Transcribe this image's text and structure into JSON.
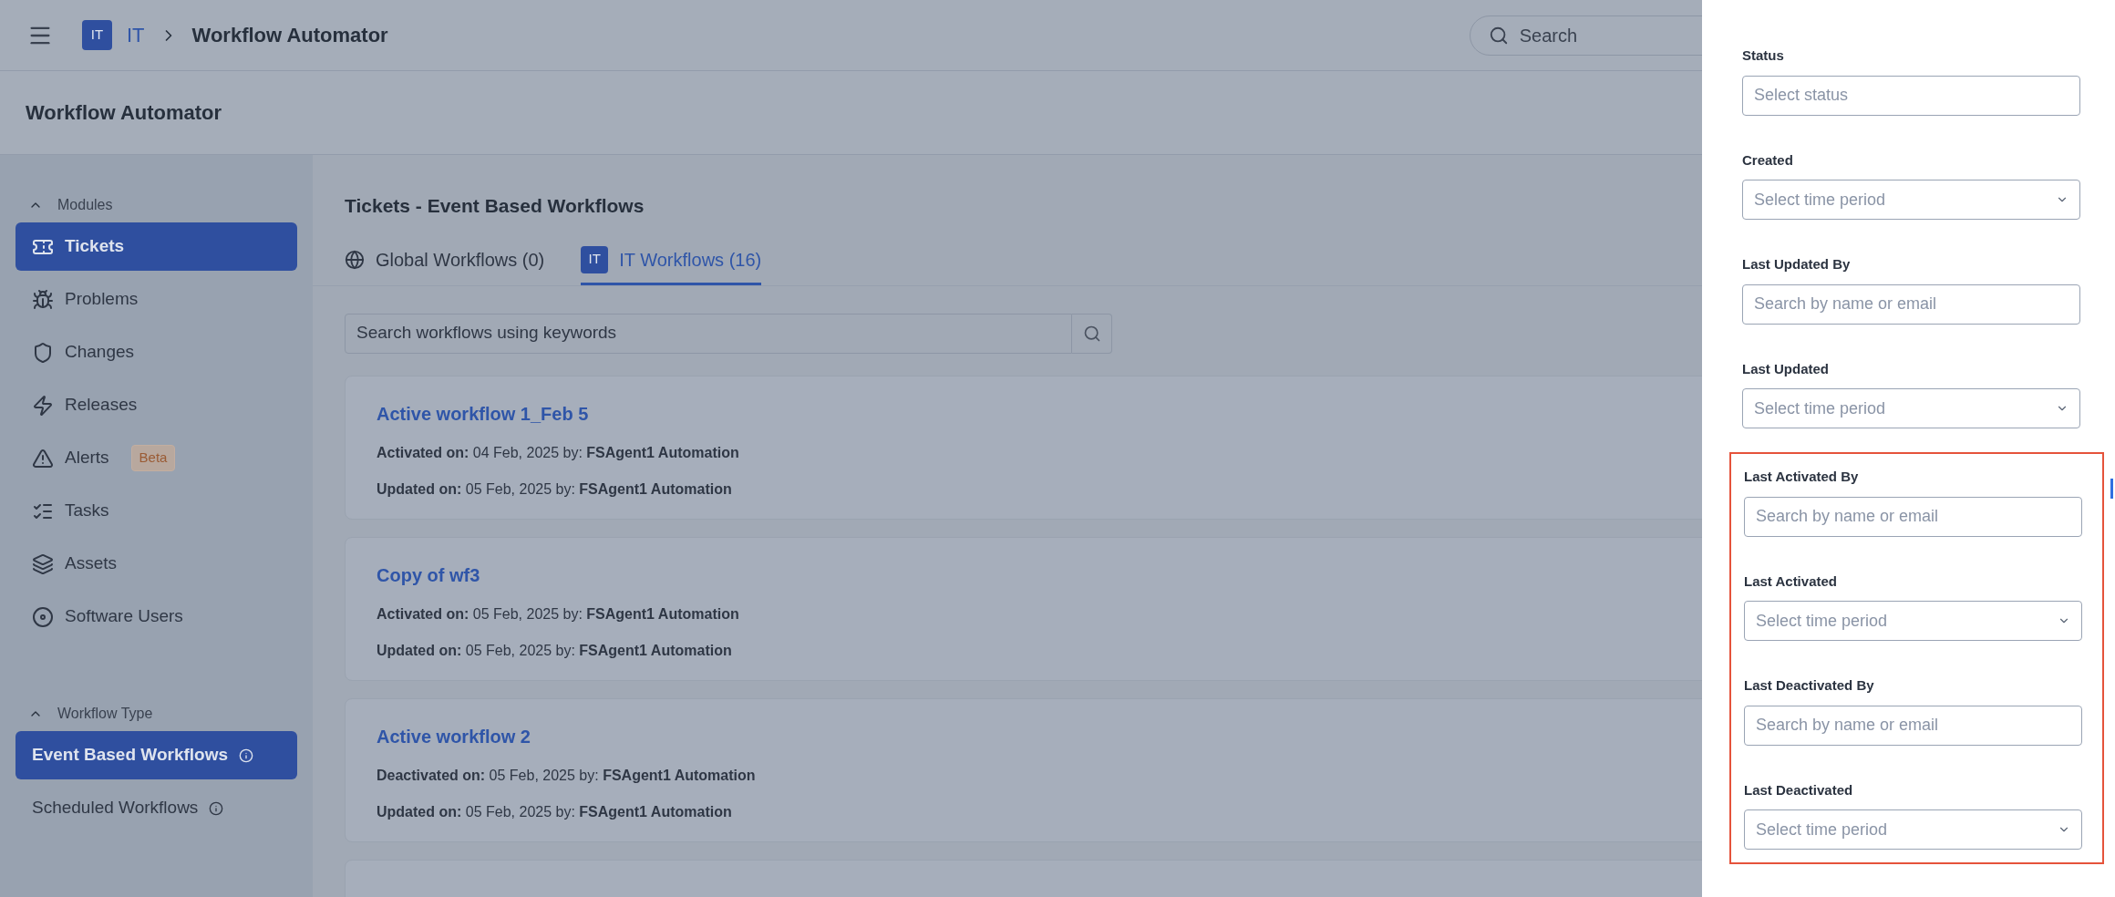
{
  "topbar": {
    "module_badge": "IT",
    "module": "IT",
    "page": "Workflow Automator",
    "search": {
      "placeholder": "Search"
    }
  },
  "page_header": {
    "title": "Workflow Automator"
  },
  "sidebar": {
    "sections": [
      {
        "title": "Modules",
        "expanded": true,
        "items": [
          {
            "label": "Tickets",
            "selected": true,
            "kind": "ticket"
          },
          {
            "label": "Problems",
            "selected": false,
            "kind": "bug"
          },
          {
            "label": "Changes",
            "selected": false,
            "kind": "shield"
          },
          {
            "label": "Releases",
            "selected": false,
            "kind": "bolt"
          },
          {
            "label": "Alerts",
            "selected": false,
            "kind": "alert",
            "badge": "Beta"
          },
          {
            "label": "Tasks",
            "selected": false,
            "kind": "tasks"
          },
          {
            "label": "Assets",
            "selected": false,
            "kind": "layers"
          },
          {
            "label": "Software Users",
            "selected": false,
            "kind": "software"
          }
        ]
      },
      {
        "title": "Workflow Type",
        "expanded": true,
        "items": [
          {
            "label": "Event Based Workflows",
            "selected": true,
            "kind": "info"
          },
          {
            "label": "Scheduled Workflows",
            "selected": false,
            "kind": "info"
          }
        ]
      }
    ]
  },
  "main": {
    "title": "Tickets - Event Based Workflows",
    "tabs": [
      {
        "label": "Global Workflows (0)",
        "selected": false,
        "kind": "globe"
      },
      {
        "label": "IT Workflows (16)",
        "selected": true,
        "kind": "badge",
        "badge": "IT"
      }
    ],
    "search": {
      "placeholder": "Search workflows using keywords"
    },
    "workflows": [
      {
        "kind": "full",
        "title": "Active workflow 1_Feb 5",
        "lines": [
          "**Activated on:** 04 Feb, 2025 by: **FSAgent1 Automation**",
          "**Updated on:** 05 Feb, 2025 by: **FSAgent1 Automation**"
        ]
      },
      {
        "kind": "full",
        "title": "Copy of wf3",
        "lines": [
          "**Activated on:** 05 Feb, 2025 by: **FSAgent1 Automation**",
          "**Updated on:** 05 Feb, 2025 by: **FSAgent1 Automation**"
        ]
      },
      {
        "kind": "full",
        "title": "Active workflow 2",
        "lines": [
          "**Deactivated on:** 05 Feb, 2025 by: **FSAgent1 Automation**",
          "**Updated on:** 05 Feb, 2025 by: **FSAgent1 Automation**"
        ]
      },
      {
        "kind": "partial"
      }
    ]
  },
  "filter_panel": {
    "groups": [
      {
        "highlighted": false,
        "fields": [
          {
            "label": "Status",
            "placeholder": "Select status",
            "kind": "text"
          },
          {
            "label": "Created",
            "placeholder": "Select time period",
            "kind": "select"
          },
          {
            "label": "Last Updated By",
            "placeholder": "Search by name or email",
            "kind": "text"
          },
          {
            "label": "Last Updated",
            "placeholder": "Select time period",
            "kind": "select"
          }
        ]
      },
      {
        "highlighted": true,
        "fields": [
          {
            "label": "Last Activated By",
            "placeholder": "Search by name or email",
            "kind": "text"
          },
          {
            "label": "Last Activated",
            "placeholder": "Select time period",
            "kind": "select"
          },
          {
            "label": "Last Deactivated By",
            "placeholder": "Search by name or email",
            "kind": "text"
          },
          {
            "label": "Last Deactivated",
            "placeholder": "Select time period",
            "kind": "select"
          }
        ]
      }
    ]
  }
}
